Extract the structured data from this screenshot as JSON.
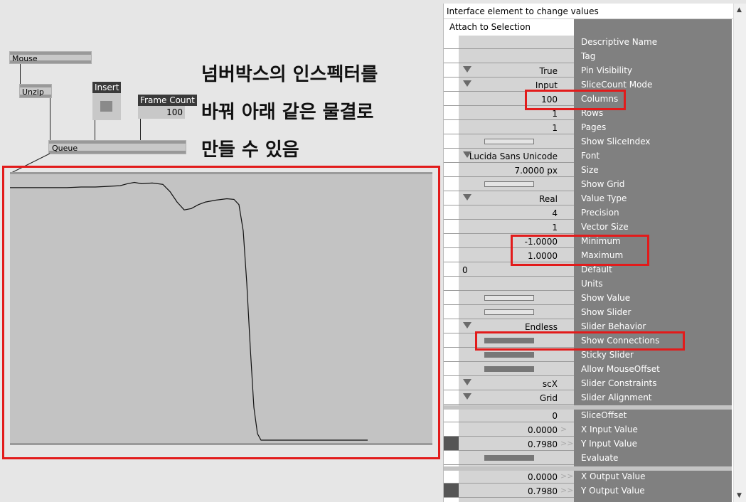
{
  "patch": {
    "mouse": "Mouse",
    "unzip": "Unzip",
    "insert_title": "Insert",
    "framecount_title": "Frame Count",
    "framecount_value": "100",
    "queue": "Queue"
  },
  "annotation": {
    "line1": "넘버박스의 인스펙터를",
    "line2": "바꿔 아래 같은 물결로",
    "line3": "만들 수 있음"
  },
  "graph": {
    "points": [
      [
        0,
        0.93
      ],
      [
        20,
        0.93
      ],
      [
        40,
        0.93
      ],
      [
        60,
        0.93
      ],
      [
        80,
        0.93
      ],
      [
        100,
        0.935
      ],
      [
        120,
        0.935
      ],
      [
        140,
        0.94
      ],
      [
        155,
        0.945
      ],
      [
        165,
        0.96
      ],
      [
        175,
        0.97
      ],
      [
        185,
        0.96
      ],
      [
        200,
        0.965
      ],
      [
        215,
        0.955
      ],
      [
        225,
        0.9
      ],
      [
        235,
        0.82
      ],
      [
        245,
        0.76
      ],
      [
        255,
        0.77
      ],
      [
        265,
        0.8
      ],
      [
        275,
        0.82
      ],
      [
        290,
        0.835
      ],
      [
        305,
        0.845
      ],
      [
        315,
        0.84
      ],
      [
        322,
        0.8
      ],
      [
        328,
        0.6
      ],
      [
        333,
        0.2
      ],
      [
        338,
        -0.3
      ],
      [
        343,
        -0.75
      ],
      [
        348,
        -0.95
      ],
      [
        353,
        -1.0
      ],
      [
        380,
        -1.0
      ],
      [
        420,
        -1.0
      ],
      [
        460,
        -1.0
      ],
      [
        503,
        -1.0
      ]
    ],
    "ylim": [
      -1,
      1
    ]
  },
  "inspector": {
    "header": "Interface element to change values",
    "attach": "Attach to Selection",
    "rows": [
      {
        "label": "Descriptive Name",
        "value": "",
        "kind": "text"
      },
      {
        "label": "Tag",
        "value": "",
        "kind": "text"
      },
      {
        "label": "Pin Visibility",
        "value": "True",
        "kind": "enum"
      },
      {
        "label": "SliceCount Mode",
        "value": "Input",
        "kind": "enum"
      },
      {
        "label": "Columns",
        "value": "100",
        "kind": "text"
      },
      {
        "label": "Rows",
        "value": "1",
        "kind": "text"
      },
      {
        "label": "Pages",
        "value": "1",
        "kind": "text"
      },
      {
        "label": "Show SliceIndex",
        "value": "",
        "kind": "toggle-off"
      },
      {
        "label": "Font",
        "value": "Lucida Sans Unicode",
        "kind": "enum"
      },
      {
        "label": "Size",
        "value": "7.0000 px",
        "kind": "text"
      },
      {
        "label": "Show Grid",
        "value": "",
        "kind": "toggle-off"
      },
      {
        "label": "Value Type",
        "value": "Real",
        "kind": "enum"
      },
      {
        "label": "Precision",
        "value": "4",
        "kind": "text"
      },
      {
        "label": "Vector Size",
        "value": "1",
        "kind": "text"
      },
      {
        "label": "Minimum",
        "value": "-1.0000",
        "kind": "text"
      },
      {
        "label": "Maximum",
        "value": "1.0000",
        "kind": "text"
      },
      {
        "label": "Default",
        "value": "0",
        "kind": "text-left"
      },
      {
        "label": "Units",
        "value": "",
        "kind": "text"
      },
      {
        "label": "Show Value",
        "value": "",
        "kind": "toggle-off"
      },
      {
        "label": "Show Slider",
        "value": "",
        "kind": "toggle-off"
      },
      {
        "label": "Slider Behavior",
        "value": "Endless",
        "kind": "enum"
      },
      {
        "label": "Show Connections",
        "value": "",
        "kind": "toggle-on"
      },
      {
        "label": "Sticky Slider",
        "value": "",
        "kind": "toggle-on"
      },
      {
        "label": "Allow MouseOffset",
        "value": "",
        "kind": "toggle-on"
      },
      {
        "label": "Slider Constraints",
        "value": "scX",
        "kind": "enum"
      },
      {
        "label": "Slider Alignment",
        "value": "Grid",
        "kind": "enum"
      }
    ],
    "pins": [
      {
        "label": "SliceOffset",
        "value": "0",
        "kind": "pin"
      },
      {
        "label": "X Input Value",
        "value": "0.0000",
        "kind": "pin-arrow1"
      },
      {
        "label": "Y Input Value",
        "value": "0.7980",
        "kind": "pin-arrow2-dark"
      },
      {
        "label": "Evaluate",
        "value": "",
        "kind": "toggle-on"
      }
    ],
    "outputs": [
      {
        "label": "X Output Value",
        "value": "0.0000",
        "kind": "pin-arrow2"
      },
      {
        "label": "Y Output Value",
        "value": "0.7980",
        "kind": "pin-arrow2-dark"
      }
    ],
    "arrow_single": ">",
    "arrow_double": ">>"
  }
}
